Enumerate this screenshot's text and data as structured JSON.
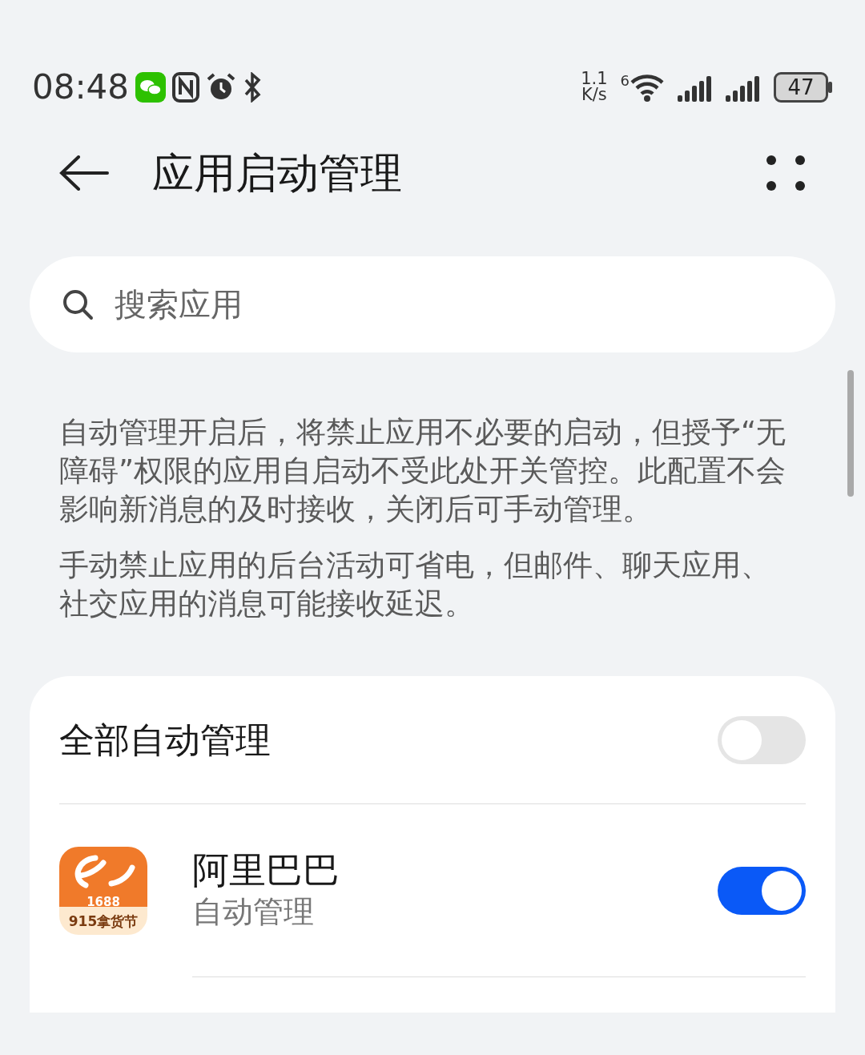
{
  "status_bar": {
    "time": "08:48",
    "net_speed": "1.1",
    "net_unit": "K/s",
    "wifi_label": "6",
    "battery": "47"
  },
  "header": {
    "title": "应用启动管理"
  },
  "search": {
    "placeholder": "搜索应用"
  },
  "descriptions": [
    "自动管理开启后，将禁止应用不必要的启动，但授予“无障碍”权限的应用自启动不受此处开关管控。此配置不会影响新消息的及时接收，关闭后可手动管理。",
    "手动禁止应用的后台活动可省电，但邮件、聊天应用、社交应用的消息可能接收延迟。"
  ],
  "master": {
    "label": "全部自动管理",
    "on": false
  },
  "apps": [
    {
      "name": "阿里巴巴",
      "status": "自动管理",
      "on": true,
      "icon_number": "1688",
      "icon_caption": "915拿货节"
    }
  ]
}
